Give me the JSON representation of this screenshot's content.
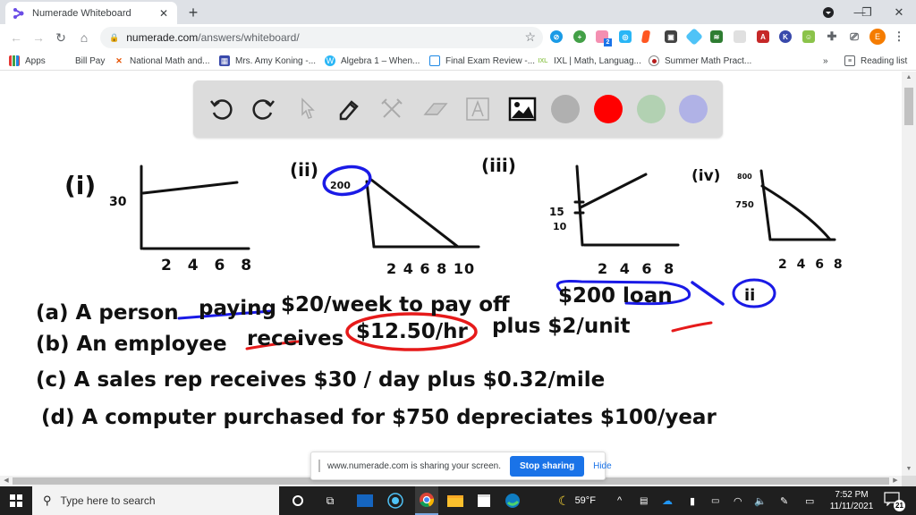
{
  "browser": {
    "tab_title": "Numerade Whiteboard",
    "url_host": "numerade.com",
    "url_path": "/answers/whiteboard/",
    "extension_badge": "2",
    "profile_initial": "E"
  },
  "bookmarks": {
    "items": [
      {
        "label": "Apps"
      },
      {
        "label": "Bill Pay"
      },
      {
        "label": "National Math and..."
      },
      {
        "label": "Mrs. Amy Koning -..."
      },
      {
        "label": "Algebra 1 – When..."
      },
      {
        "label": "Final Exam Review -..."
      },
      {
        "label": "IXL | Math, Languag..."
      },
      {
        "label": "Summer Math Pract..."
      }
    ],
    "overflow": "»",
    "reading_list": "Reading list"
  },
  "whiteboard": {
    "tools": [
      "undo",
      "redo",
      "select",
      "pen",
      "tools",
      "eraser",
      "text",
      "image"
    ],
    "colors": [
      "#b0b0b0",
      "#ff0000",
      "#b2d1b2",
      "#b0b2e6"
    ],
    "graphs": [
      {
        "label": "(i)",
        "y_label": "30",
        "x_ticks": "2 4 6 8"
      },
      {
        "label": "(ii)",
        "y_label": "200",
        "x_ticks": "2 4 6 8 10"
      },
      {
        "label": "(iii)",
        "y_labels": [
          "15",
          "10"
        ],
        "x_ticks": "2 4 6 8"
      },
      {
        "label": "(iv)",
        "y_labels": [
          "800",
          "750"
        ],
        "x_ticks": "2 4 6 8"
      }
    ],
    "lines": [
      {
        "id": "a",
        "text": "(a) A person paying $20/week to pay off $200 loan",
        "match": "ii"
      },
      {
        "id": "b",
        "text": "(b) An employee receives $12.50/hr plus $2/unit"
      },
      {
        "id": "c",
        "text": "(c) A sales rep receives $30 / day plus $0.32/mile"
      },
      {
        "id": "d",
        "text": "(d) A computer purchased for $750 depreciates $100/year"
      }
    ],
    "hw": {
      "a_prefix": "(a) A person",
      "a_paying": "paying",
      "a_mid": "$20/week to pay off",
      "a_amount": "$200 loan",
      "a_match": "ii",
      "b_prefix": "(b) An employee",
      "b_receives": "receives",
      "b_rate": "$12.50/hr",
      "b_suffix": "plus $2/unit",
      "c_text": "(c) A sales rep receives $30 / day plus $0.32/mile",
      "d_text": "(d) A computer purchased for $750 depreciates $100/year"
    }
  },
  "share_banner": {
    "message": "www.numerade.com is sharing your screen.",
    "stop_label": "Stop sharing",
    "hide_label": "Hide"
  },
  "taskbar": {
    "search_placeholder": "Type here to search",
    "weather": "59°F",
    "time": "7:52 PM",
    "date": "11/11/2021",
    "notification_count": "21"
  }
}
